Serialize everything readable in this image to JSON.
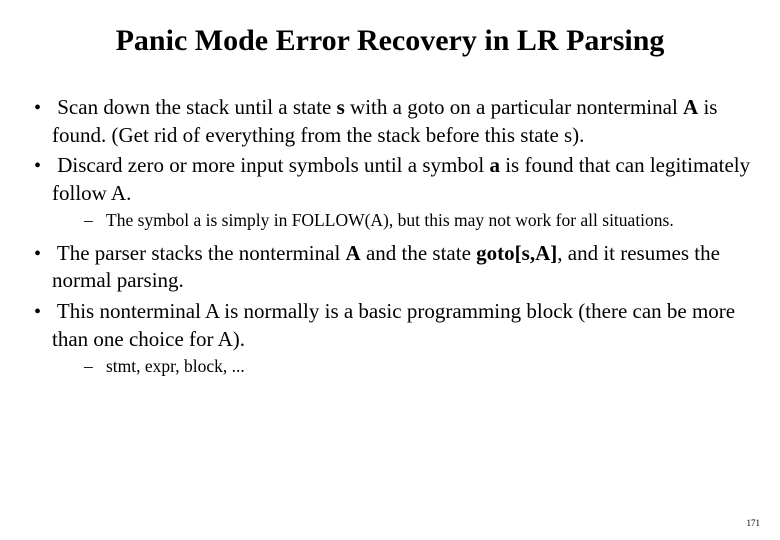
{
  "title": "Panic Mode Error Recovery in LR Parsing",
  "bullets": {
    "b1_pre": "Scan down the stack until a state ",
    "b1_s": "s",
    "b1_mid1": " with a goto on a particular nonterminal ",
    "b1_A": "A",
    "b1_post": " is found. (Get rid of everything from the stack before this state s).",
    "b2_pre": "Discard zero or more input symbols until a symbol ",
    "b2_a": "a",
    "b2_post": " is found that can legitimately follow A.",
    "b2_sub": "The symbol a is simply in FOLLOW(A), but this may not work for all situations.",
    "b3_pre": "The parser stacks the nonterminal ",
    "b3_A": "A",
    "b3_mid": " and  the state ",
    "b3_goto": "goto[s,A]",
    "b3_post": ", and it resumes the normal parsing.",
    "b4": "This nonterminal A is normally is a basic programming block (there can be more than one choice for A).",
    "b4_sub": "stmt, expr, block, ..."
  },
  "page_number": "171"
}
